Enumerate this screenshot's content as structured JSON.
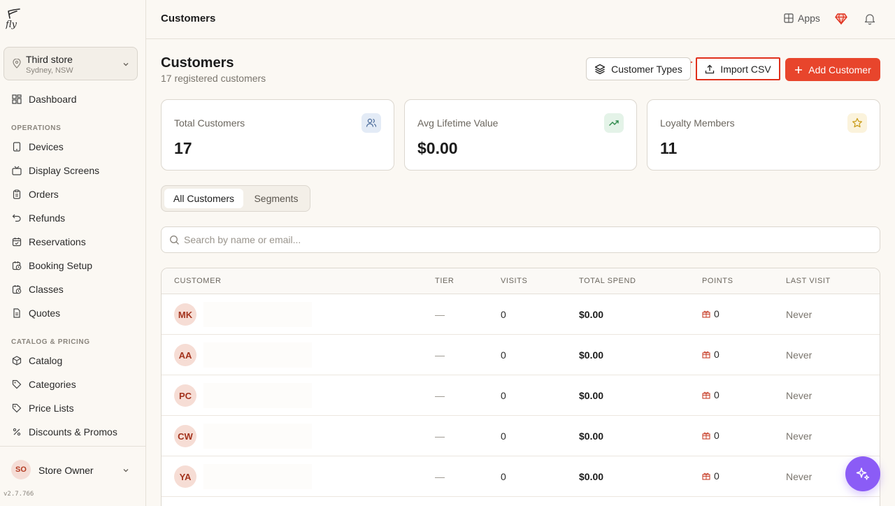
{
  "sidebar": {
    "store": {
      "name": "Third store",
      "location": "Sydney, NSW"
    },
    "dashboard": "Dashboard",
    "sections": {
      "operations": "OPERATIONS",
      "catalog": "CATALOG & PRICING"
    },
    "operations_items": [
      "Devices",
      "Display Screens",
      "Orders",
      "Refunds",
      "Reservations",
      "Booking Setup",
      "Classes",
      "Quotes"
    ],
    "catalog_items": [
      "Catalog",
      "Categories",
      "Price Lists",
      "Discounts & Promos"
    ],
    "user": {
      "initials": "SO",
      "name": "Store Owner"
    },
    "version": "v2.7.766"
  },
  "topbar": {
    "title": "Customers",
    "apps_label": "Apps"
  },
  "header": {
    "title": "Customers",
    "subtitle": "17 registered customers",
    "customer_types_label": "Customer Types",
    "import_label": "Import CSV",
    "add_label": "Add Customer"
  },
  "stats": [
    {
      "label": "Total Customers",
      "value": "17"
    },
    {
      "label": "Avg Lifetime Value",
      "value": "$0.00"
    },
    {
      "label": "Loyalty Members",
      "value": "11"
    }
  ],
  "tabs": {
    "all": "All Customers",
    "segments": "Segments"
  },
  "search": {
    "placeholder": "Search by name or email..."
  },
  "table": {
    "headers": {
      "customer": "CUSTOMER",
      "tier": "TIER",
      "visits": "VISITS",
      "spend": "TOTAL SPEND",
      "points": "POINTS",
      "last": "LAST VISIT"
    },
    "rows": [
      {
        "initials": "MK",
        "tier": "—",
        "visits": "0",
        "spend": "$0.00",
        "points": "0",
        "last": "Never"
      },
      {
        "initials": "AA",
        "tier": "—",
        "visits": "0",
        "spend": "$0.00",
        "points": "0",
        "last": "Never"
      },
      {
        "initials": "PC",
        "tier": "—",
        "visits": "0",
        "spend": "$0.00",
        "points": "0",
        "last": "Never"
      },
      {
        "initials": "CW",
        "tier": "—",
        "visits": "0",
        "spend": "$0.00",
        "points": "0",
        "last": "Never"
      },
      {
        "initials": "YA",
        "tier": "—",
        "visits": "0",
        "spend": "$0.00",
        "points": "0",
        "last": "Never"
      }
    ]
  },
  "colors": {
    "accent": "#e8452c",
    "fab": "#8b5cf6",
    "background": "#fbf8f3"
  }
}
